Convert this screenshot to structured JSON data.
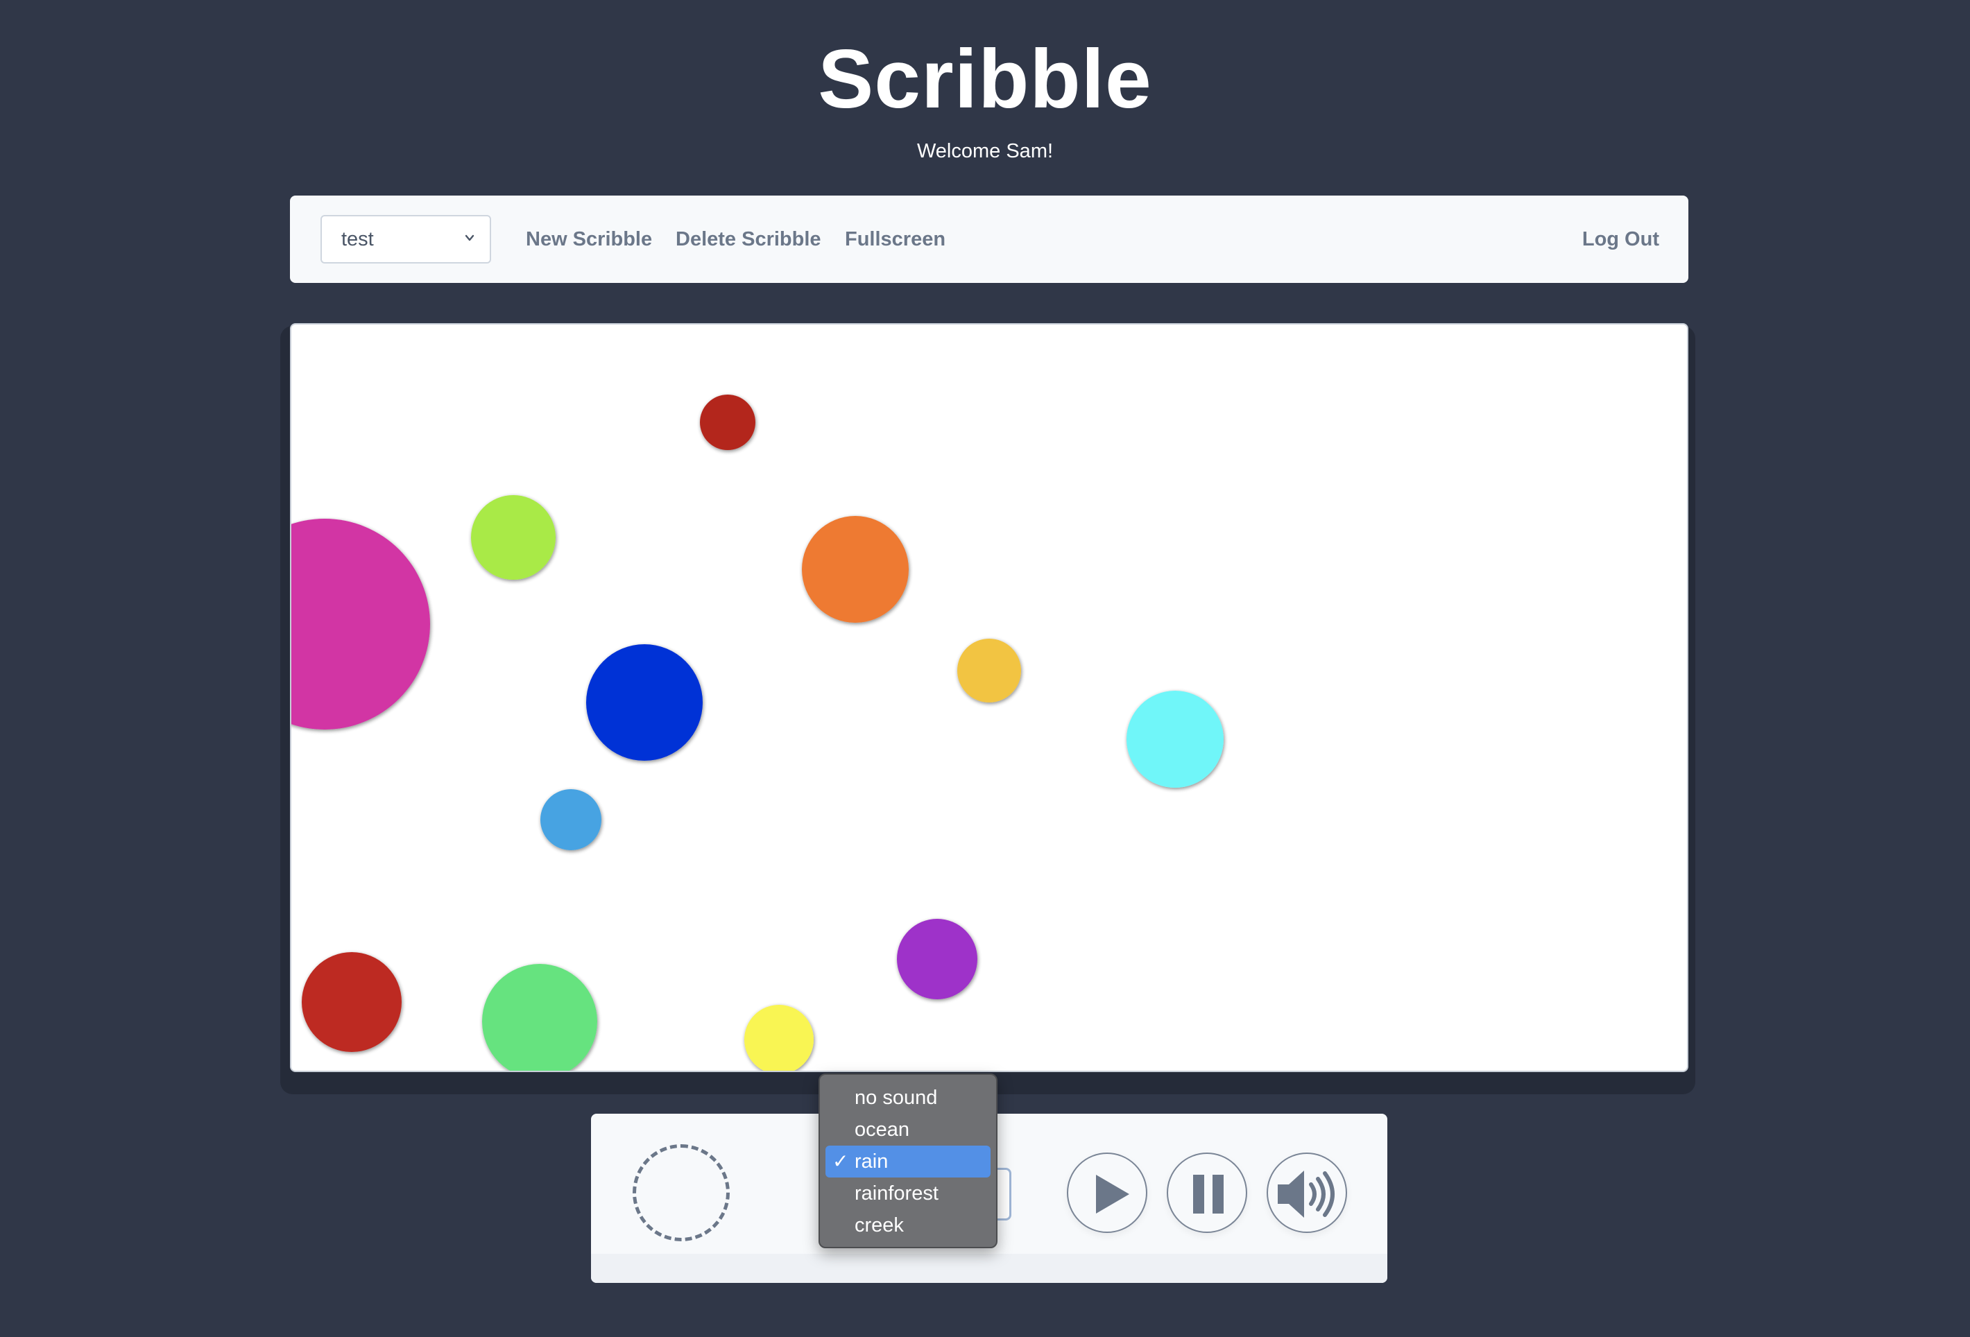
{
  "app": {
    "title": "Scribble",
    "welcome": "Welcome Sam!"
  },
  "navbar": {
    "scribble_select": {
      "value": "test"
    },
    "links": [
      "New Scribble",
      "Delete Scribble",
      "Fullscreen"
    ],
    "logout": "Log Out"
  },
  "canvas": {
    "circle_colors": [
      "#b3281e",
      "#a9ea47",
      "#d235a4",
      "#ee7a31",
      "#0032d6",
      "#f2c443",
      "#6ff6f9",
      "#46a3e2",
      "#9e32c9",
      "#bd2a22",
      "#66e37f",
      "#f9f553"
    ]
  },
  "controls": {
    "sound_options": [
      "no sound",
      "ocean",
      "rain",
      "rainforest",
      "creek"
    ],
    "selected_sound": "rain",
    "check_mark": "✓",
    "icons": [
      "loading-spinner-icon",
      "play-icon",
      "pause-icon",
      "volume-icon",
      "chevron-down-icon"
    ]
  },
  "colors": {
    "background": "#303748",
    "panel": "#f7f9fb",
    "link": "#6b7789",
    "dropdown_highlight": "#5390e6"
  }
}
